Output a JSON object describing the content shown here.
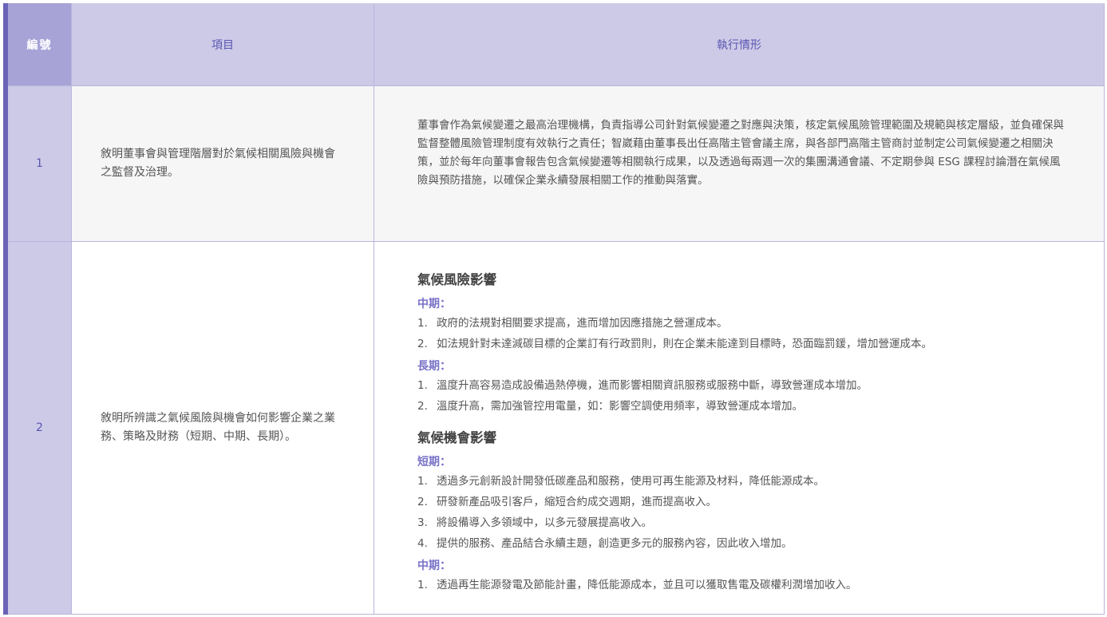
{
  "header": {
    "num": "編號",
    "item": "項目",
    "exec": "執行情形"
  },
  "rows": [
    {
      "num": "1",
      "item": "敘明董事會與管理階層對於氣候相關風險與機會之監督及治理。",
      "exec": "董事會作為氣候變遷之最高治理機構，負責指導公司針對氣候變遷之對應與決策，核定氣候風險管理範圍及規範與核定層級，並負確保與監督整體風險管理制度有效執行之責任；智崴藉由董事長出任高階主管會議主席，與各部門高階主管商討並制定公司氣候變遷之相關決策，並於每年向董事會報告包含氣候變遷等相關執行成果，以及透過每兩週一次的集團溝通會議、不定期參與 ESG 課程討論潛在氣候風險與預防措施，以確保企業永續發展相關工作的推動與落實。"
    },
    {
      "num": "2",
      "item": "敘明所辨識之氣候風險與機會如何影響企業之業務、策略及財務（短期、中期、長期）。",
      "risk": {
        "title": "氣候風險影響",
        "mid_label": "中期：",
        "mid": [
          "政府的法規對相關要求提高，進而增加因應措施之營運成本。",
          "如法規針對未達減碳目標的企業訂有行政罰則，則在企業未能達到目標時，恐面臨罰鍰，增加營運成本。"
        ],
        "long_label": "長期：",
        "long": [
          "溫度升高容易造成設備過熱停機，進而影響相關資訊服務或服務中斷，導致營運成本增加。",
          "溫度升高，需加強管控用電量，如：影響空調使用頻率，導致營運成本增加。"
        ]
      },
      "opp": {
        "title": "氣候機會影響",
        "short_label": "短期：",
        "short": [
          "透過多元創新設計開發低碳產品和服務，使用可再生能源及材料，降低能源成本。",
          "研發新產品吸引客戶，縮短合約成交週期，進而提高收入。",
          "將設備導入多領域中，以多元發展提高收入。",
          "提供的服務、產品結合永續主題，創造更多元的服務內容，因此收入增加。"
        ],
        "mid_label": "中期：",
        "mid": [
          "透過再生能源發電及節能計畫，降低能源成本，並且可以獲取售電及碳權利潤增加收入。"
        ]
      }
    }
  ],
  "numbers": [
    "1.",
    "2.",
    "3.",
    "4."
  ]
}
